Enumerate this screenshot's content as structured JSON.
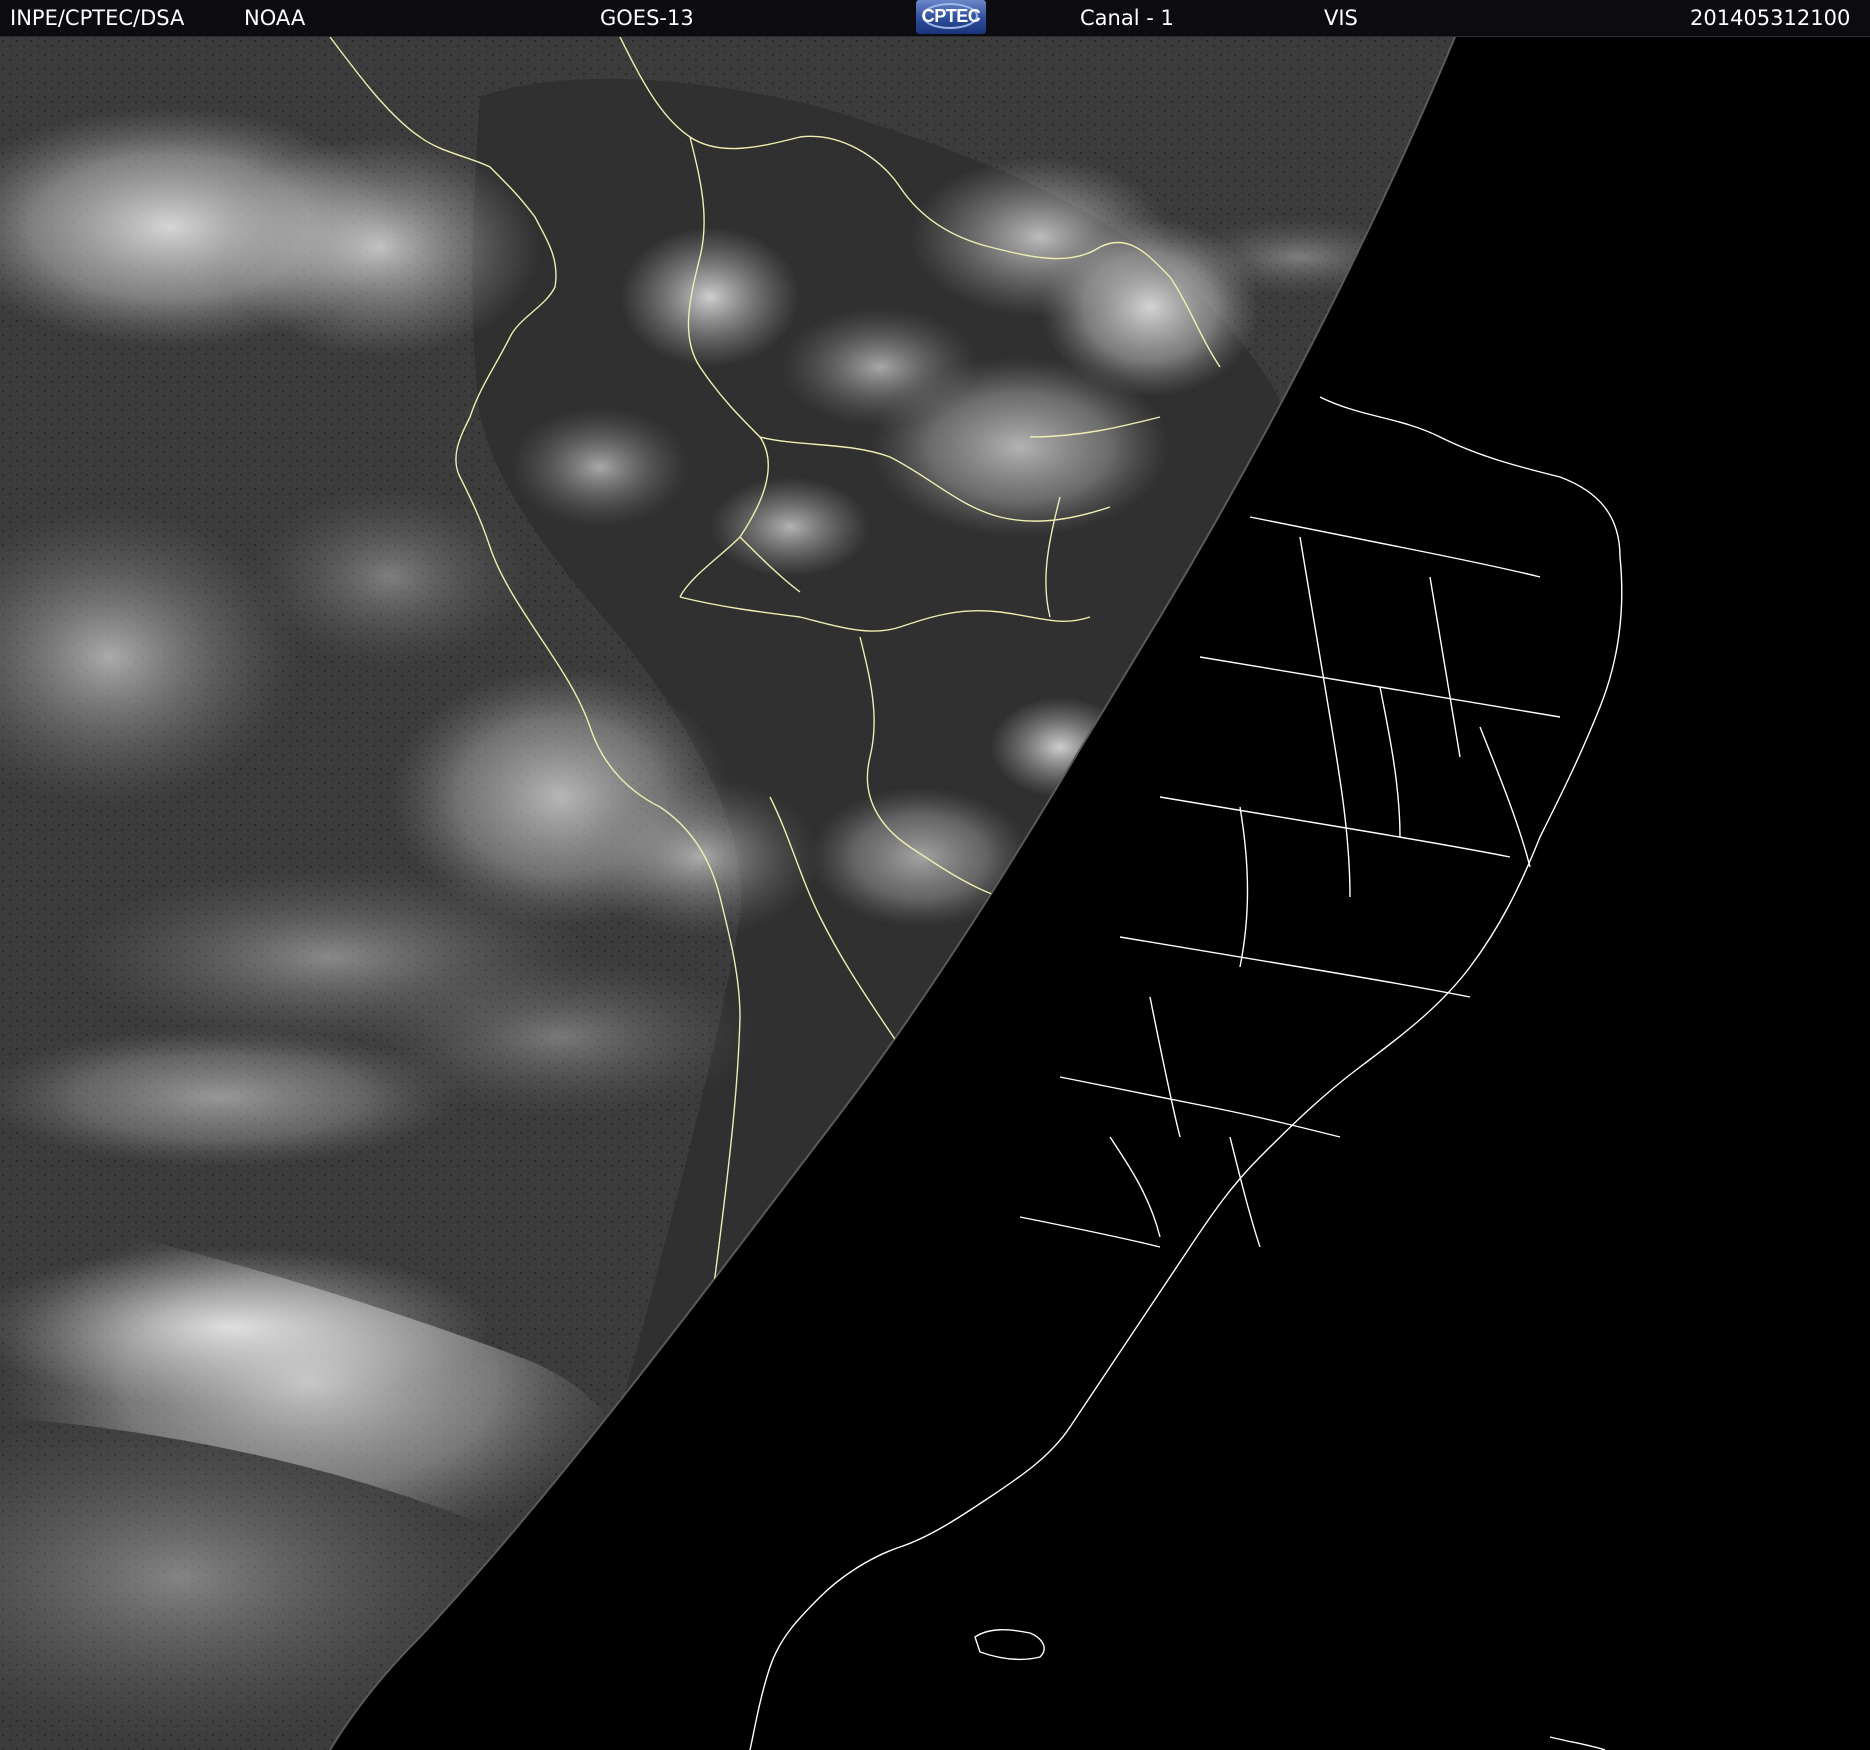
{
  "header": {
    "source": "INPE/CPTEC/DSA",
    "agency": "NOAA",
    "satellite": "GOES-13",
    "logo_text": "CPTEC",
    "channel": "Canal - 1",
    "band": "VIS",
    "timestamp": "201405312100"
  },
  "image": {
    "description_colors": {
      "night_side": "#000000",
      "ocean_day": "#3c3c3c",
      "clouds": "#d8d8d8",
      "boundaries_day": "#f2f0b8",
      "boundaries_night": "#ffffff"
    },
    "icon": "cptec-logo-icon"
  }
}
